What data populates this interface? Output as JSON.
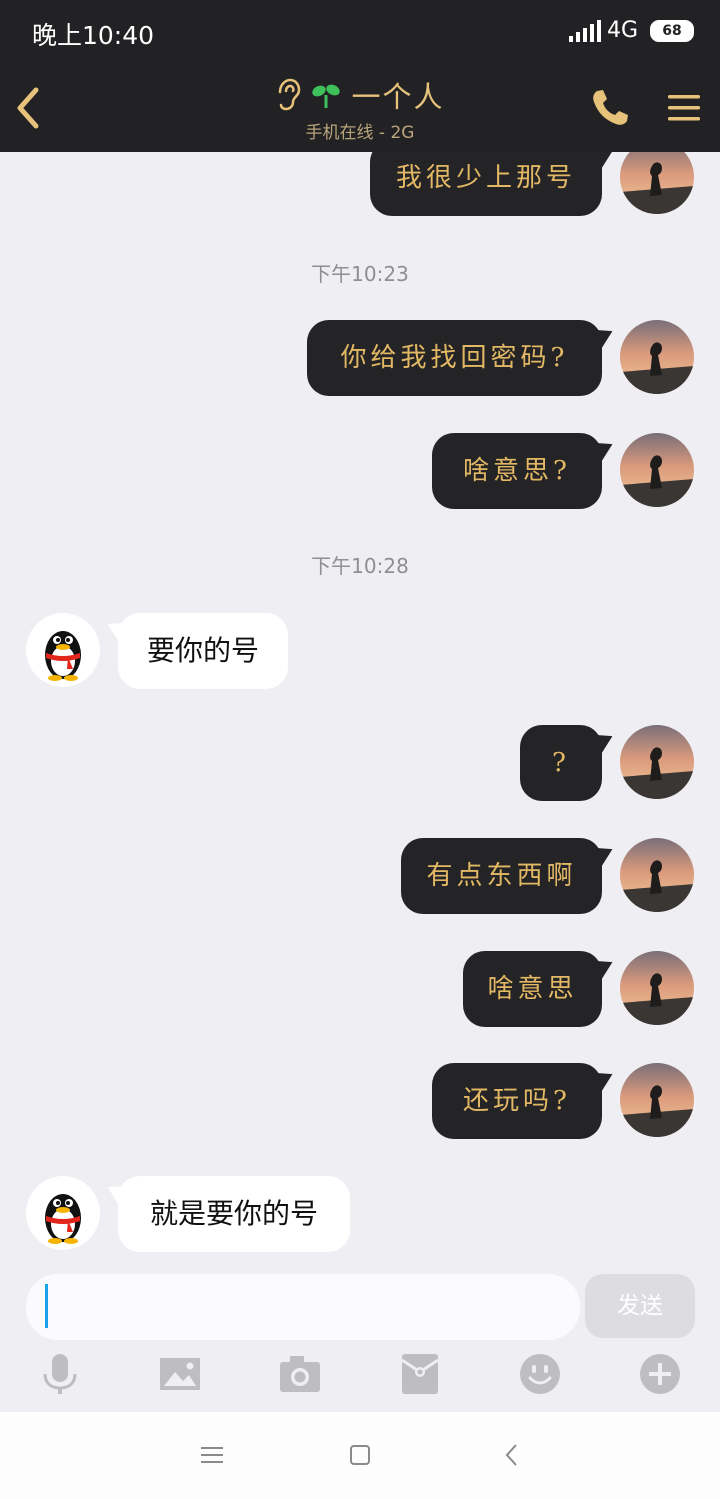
{
  "status_bar": {
    "time": "晚上10:40",
    "network": "4G",
    "battery": "68"
  },
  "header": {
    "title": "一个人",
    "subtitle": "手机在线 - 2G"
  },
  "messages": [
    {
      "side": "out",
      "text": "我很少上那号"
    },
    {
      "type": "timestamp",
      "text": "下午10:23"
    },
    {
      "side": "out",
      "text": "你给我找回密码?"
    },
    {
      "side": "out",
      "text": "啥意思?"
    },
    {
      "type": "timestamp",
      "text": "下午10:28"
    },
    {
      "side": "in",
      "text": "要你的号"
    },
    {
      "side": "out",
      "text": "?"
    },
    {
      "side": "out",
      "text": "有点东西啊"
    },
    {
      "side": "out",
      "text": "啥意思"
    },
    {
      "side": "out",
      "text": "还玩吗?"
    },
    {
      "side": "in",
      "text": "就是要你的号"
    }
  ],
  "input": {
    "placeholder": "",
    "send_label": "发送"
  },
  "toolbar": [
    "microphone-icon",
    "image-icon",
    "camera-icon",
    "red-packet-icon",
    "emoji-icon",
    "plus-icon"
  ],
  "colors": {
    "bar": "#222225",
    "accent": "#e6c27a",
    "bubble_out": "#242426",
    "bubble_out_text": "#e3b865",
    "background": "#eeeef3"
  }
}
